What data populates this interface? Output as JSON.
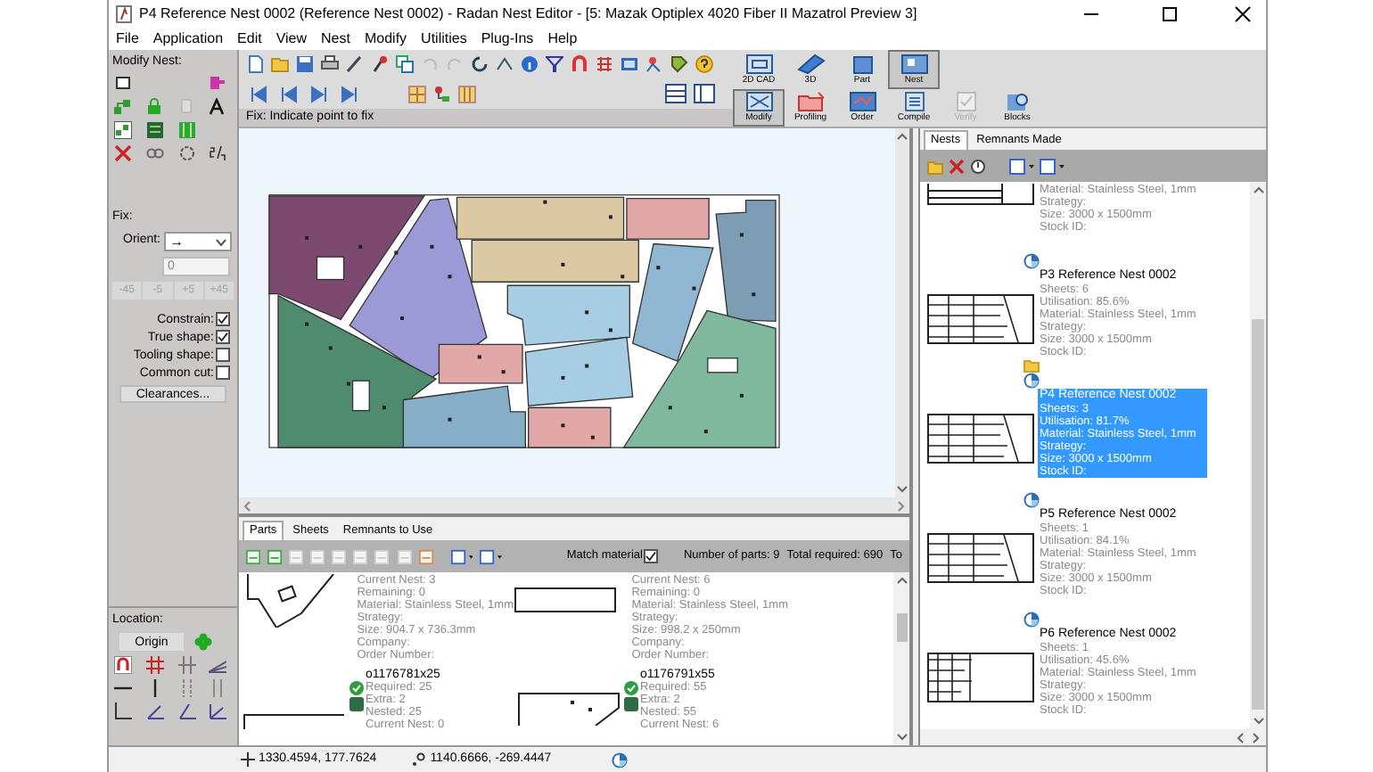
{
  "window": {
    "title": "P4 Reference Nest 0002 (Reference Nest 0002) - Radan Nest Editor - [5: Mazak Optiplex 4020 Fiber II Mazatrol Preview 3]"
  },
  "menu": [
    {
      "label": "File"
    },
    {
      "label": "Application"
    },
    {
      "label": "Edit"
    },
    {
      "label": "View"
    },
    {
      "label": "Nest"
    },
    {
      "label": "Modify"
    },
    {
      "label": "Utilities"
    },
    {
      "label": "Plug-Ins"
    },
    {
      "label": "Help"
    }
  ],
  "modify_nest": {
    "title": "Modify Nest:",
    "fix_label": "Fix:",
    "orient_label": "Orient:",
    "orient_value": "→",
    "angle_value": "0",
    "steps": [
      {
        "label": "-45",
        "disabled": true
      },
      {
        "label": "-5",
        "disabled": true
      },
      {
        "label": "+5",
        "disabled": true
      },
      {
        "label": "+45",
        "disabled": true
      }
    ],
    "options": [
      {
        "label": "Constrain:",
        "checked": true
      },
      {
        "label": "True shape:",
        "checked": true
      },
      {
        "label": "Tooling shape:",
        "checked": false
      },
      {
        "label": "Common cut:",
        "checked": false
      }
    ],
    "clearances": "Clearances...",
    "location_label": "Location:",
    "origin": "Origin"
  },
  "modes": [
    [
      {
        "label": "2D CAD",
        "selected": false,
        "disabled": false
      },
      {
        "label": "3D",
        "selected": false,
        "disabled": false
      },
      {
        "label": "Part",
        "selected": false,
        "disabled": false
      },
      {
        "label": "Nest",
        "selected": true,
        "disabled": false
      }
    ],
    [
      {
        "label": "Modify",
        "selected": true,
        "disabled": false
      },
      {
        "label": "Profiling",
        "selected": false,
        "disabled": false
      },
      {
        "label": "Order",
        "selected": false,
        "disabled": false
      },
      {
        "label": "Compile",
        "selected": false,
        "disabled": false
      },
      {
        "label": "Verify",
        "selected": false,
        "disabled": true
      },
      {
        "label": "Blocks",
        "selected": false,
        "disabled": false
      }
    ]
  ],
  "fix_prompt": "Fix: Indicate point to fix",
  "parts_panel": {
    "tabs": [
      {
        "label": "Parts",
        "selected": true
      },
      {
        "label": "Sheets",
        "selected": false
      },
      {
        "label": "Remnants to Use",
        "selected": false
      }
    ],
    "match_material": {
      "label": "Match material",
      "checked": true
    },
    "number_of_parts": "Number of parts: 9",
    "total_required": "Total required: 690",
    "cut_label": "To",
    "columns": [
      [
        {
          "lines": [
            "Current Nest: 3",
            "Remaining: 0",
            "Material: Stainless Steel, 1mm",
            "Strategy:",
            "Size: 904.7 x 736.3mm",
            "Company:",
            "Order Number:"
          ]
        },
        {
          "name": "o1176781x25",
          "lines": [
            "Required: 25",
            "Extra: 2",
            "Nested: 25",
            "Current Nest: 0"
          ]
        }
      ],
      [
        {
          "lines": [
            "Current Nest: 6",
            "Remaining: 0",
            "Material: Stainless Steel, 1mm",
            "Strategy:",
            "Size: 998.2 x 250mm",
            "Company:",
            "Order Number:"
          ]
        },
        {
          "name": "o1176791x55",
          "lines": [
            "Required: 55",
            "Extra: 2",
            "Nested: 55",
            "Current Nest: 6"
          ]
        }
      ]
    ]
  },
  "nests_panel": {
    "tabs": [
      {
        "label": "Nests",
        "selected": true
      },
      {
        "label": "Remnants Made",
        "selected": false
      }
    ],
    "nests": [
      {
        "lines": [
          "Material: Stainless Steel, 1mm",
          "Strategy:",
          "Size: 3000 x 1500mm",
          "Stock ID:"
        ],
        "selected": false,
        "current": false
      },
      {
        "title": "P3 Reference Nest 0002",
        "lines": [
          "Sheets: 6",
          "Utilisation: 85.6%",
          "Material: Stainless Steel, 1mm",
          "Strategy:",
          "Size: 3000 x 1500mm",
          "Stock ID:"
        ],
        "selected": false,
        "current": false
      },
      {
        "title": "P4 Reference Nest 0002",
        "lines": [
          "Sheets: 3",
          "Utilisation: 81.7%",
          "Material: Stainless Steel, 1mm",
          "Strategy:",
          "Size: 3000 x 1500mm",
          "Stock ID:"
        ],
        "selected": true,
        "current": true
      },
      {
        "title": "P5 Reference Nest 0002",
        "lines": [
          "Sheets: 1",
          "Utilisation: 84.1%",
          "Material: Stainless Steel, 1mm",
          "Strategy:",
          "Size: 3000 x 1500mm",
          "Stock ID:"
        ],
        "selected": false,
        "current": false
      },
      {
        "title": "P6 Reference Nest 0002",
        "lines": [
          "Sheets: 1",
          "Utilisation: 45.6%",
          "Material: Stainless Steel, 1mm",
          "Strategy:",
          "Size: 3000 x 1500mm",
          "Stock ID:"
        ],
        "selected": false,
        "current": false
      }
    ]
  },
  "status_bar": {
    "cursor": "1330.4594, 177.7624",
    "offset": "1140.6666, -269.4447"
  }
}
